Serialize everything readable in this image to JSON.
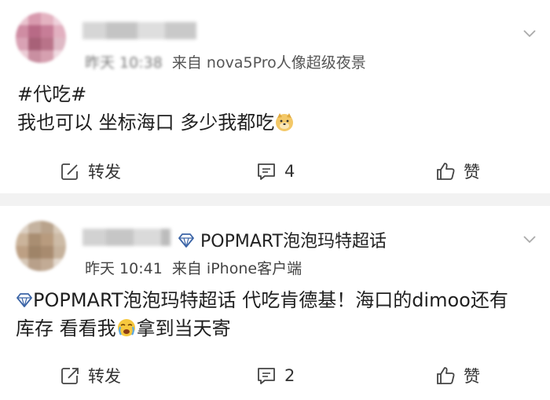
{
  "posts": [
    {
      "meta_time": "昨天 10:38",
      "meta_source": "来自 nova5Pro人像超级夜景",
      "line1": "#代吃#",
      "line2": "我也可以 坐标海口 多少我都吃",
      "emoji": "doge-emoji",
      "actions": {
        "repost": "转发",
        "comment_count": "4",
        "like": "赞"
      }
    },
    {
      "topic": "POPMART泡泡玛特超话",
      "meta_time": "昨天 10:41",
      "meta_source": "来自 iPhone客户端",
      "line1_topic": "POPMART泡泡玛特超话",
      "line1_rest": " 代吃肯德基！海口的dimoo还有",
      "line2_a": "库存 看看我",
      "line2_b": "拿到当天寄",
      "emoji": "crying-emoji",
      "actions": {
        "repost": "转发",
        "comment_count": "2",
        "like": "赞"
      }
    }
  ],
  "colors": {
    "topic": "#3b64a6",
    "divider": "#f2f2f2",
    "text": "#1f1f1f",
    "meta": "#555555"
  },
  "icons": [
    "chevron-down-icon",
    "repost-icon",
    "comment-icon",
    "like-icon",
    "diamond-icon"
  ]
}
